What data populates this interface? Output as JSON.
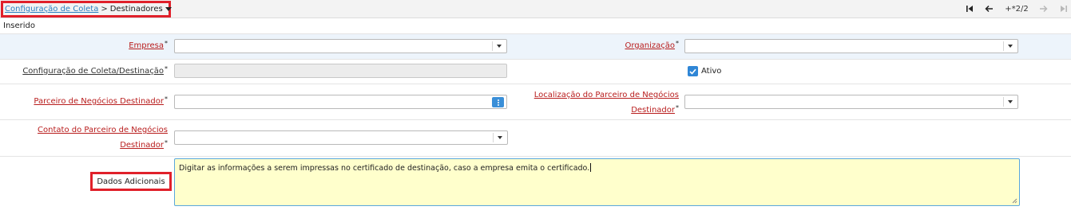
{
  "breadcrumb": {
    "parent": "Configuração de Coleta",
    "separator": ">",
    "current": "Destinadores"
  },
  "navigation": {
    "record_counter": "+*2/2"
  },
  "status": "Inserido",
  "fields": {
    "empresa": {
      "label": "Empresa",
      "value": ""
    },
    "organizacao": {
      "label": "Organização",
      "value": ""
    },
    "config_destinacao": {
      "label": "Configuração de Coleta/Destinação",
      "value": ""
    },
    "ativo": {
      "label": "Ativo",
      "checked": true
    },
    "parceiro_destinador": {
      "label": "Parceiro de Negócios Destinador",
      "value": ""
    },
    "localizacao_label_line1": "Localização do Parceiro de Negócios",
    "localizacao_label_line2": "Destinador",
    "localizacao": {
      "value": ""
    },
    "contato_label_line1": "Contato do Parceiro de Negócios",
    "contato_label_line2": "Destinador",
    "contato": {
      "value": ""
    },
    "dados_adicionais": {
      "label": "Dados Adicionais",
      "value": "Digitar as informações a serem impressas no certificado de destinação, caso a empresa emita o certificado."
    }
  },
  "required_marker": "*",
  "colors": {
    "highlight": "#e0202a",
    "required_label": "#b81c1c",
    "link": "#2a7fc1",
    "textarea_bg": "#ffffcc",
    "checkbox": "#2f86d6"
  }
}
